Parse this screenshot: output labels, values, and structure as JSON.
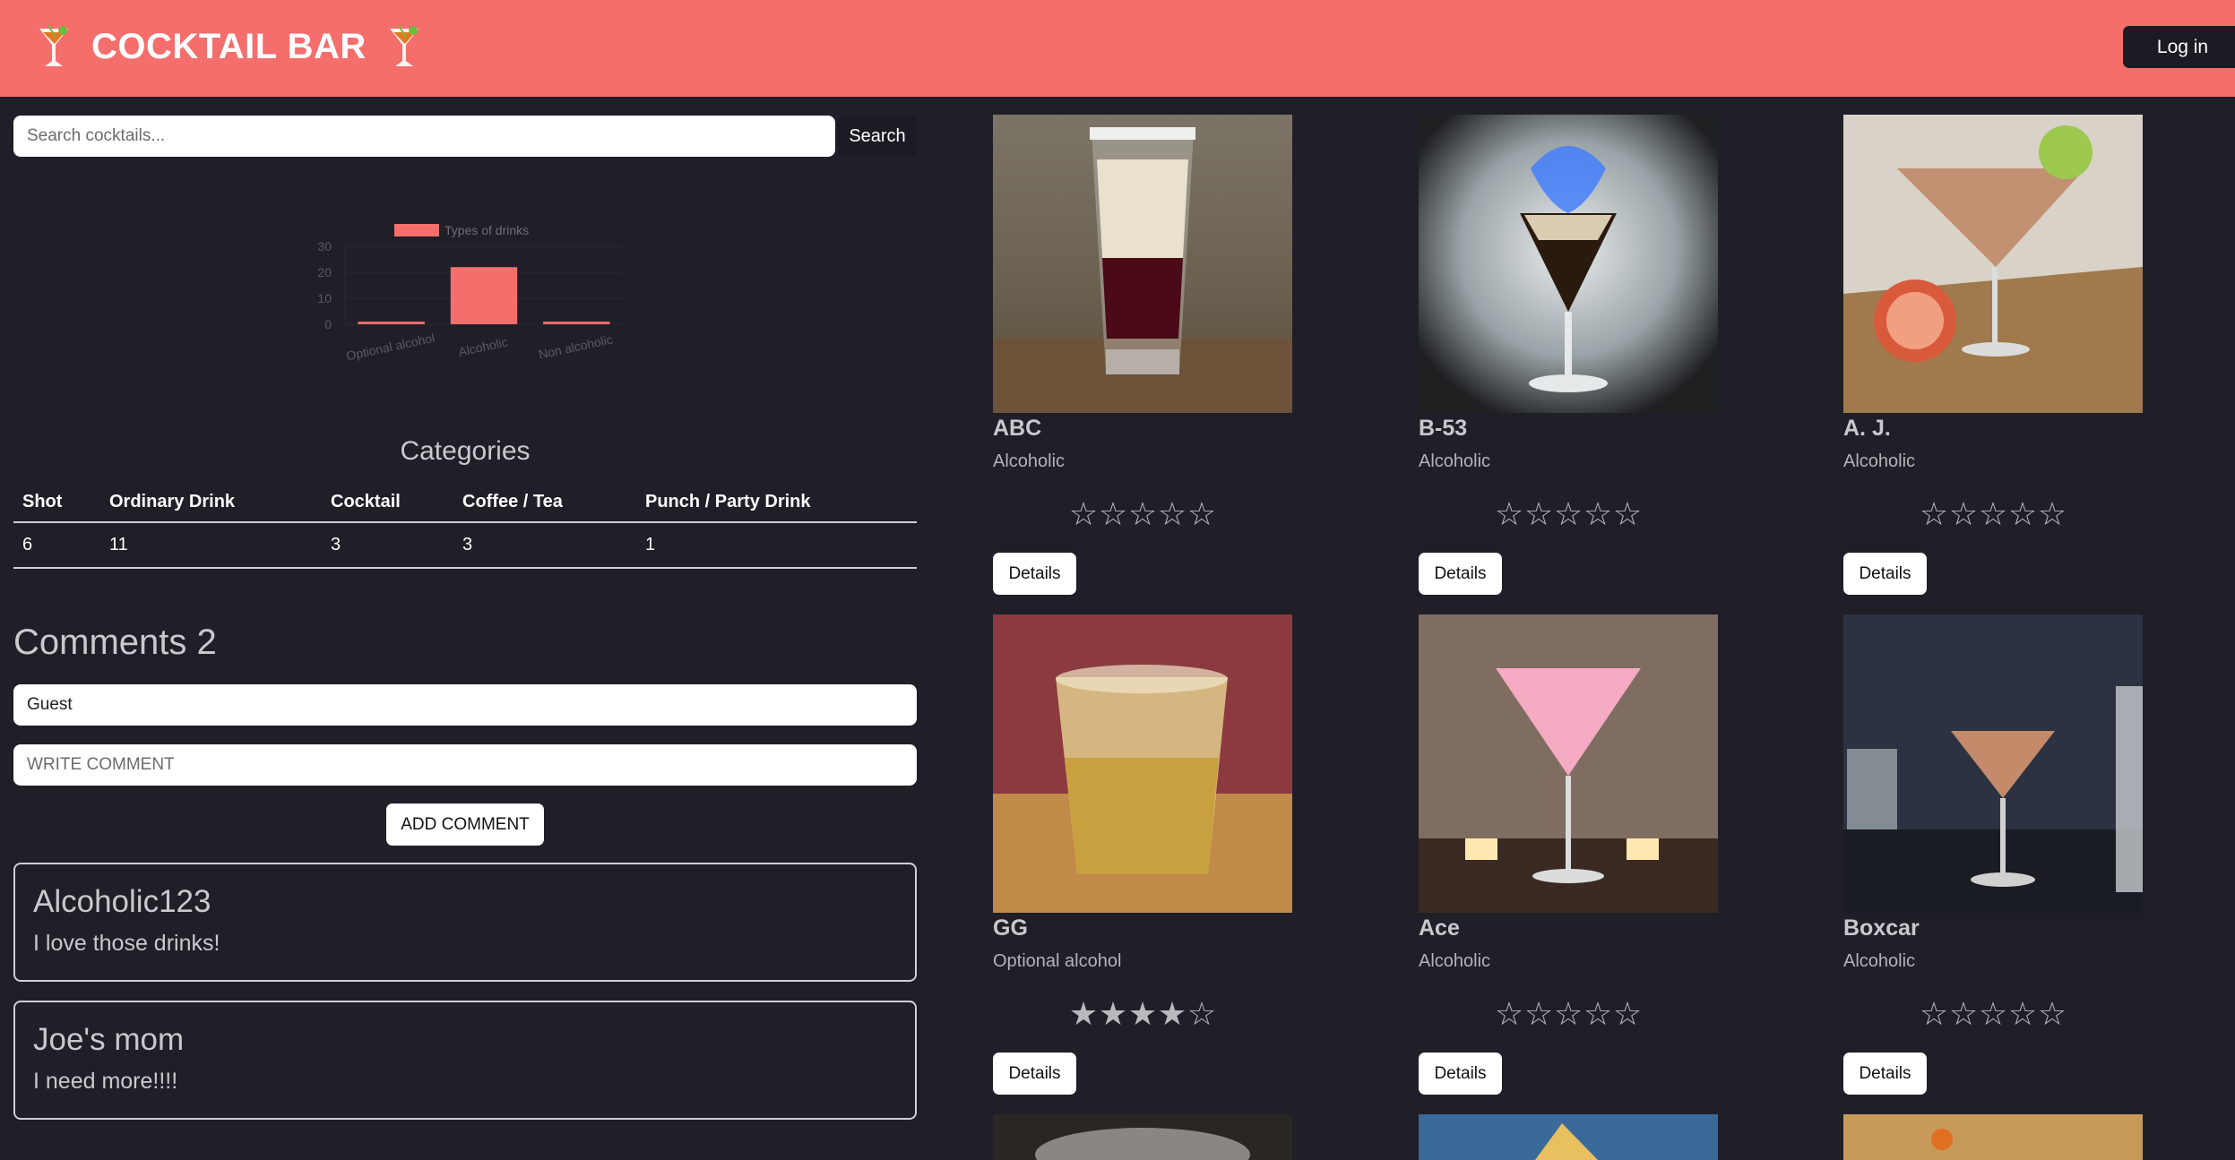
{
  "header": {
    "title": "COCKTAIL BAR",
    "login_label": "Log in"
  },
  "search": {
    "placeholder": "Search cocktails...",
    "button_label": "Search"
  },
  "chart_data": {
    "type": "bar",
    "categories": [
      "Optional alcohol",
      "Alcoholic",
      "Non alcoholic"
    ],
    "series": [
      {
        "name": "Types of drinks",
        "values": [
          1,
          22,
          1
        ]
      }
    ],
    "ylim": [
      0,
      30
    ],
    "yticks": [
      0,
      10,
      20,
      30
    ],
    "legend": "top",
    "color": "#f46e6c"
  },
  "categories": {
    "title": "Categories",
    "headers": [
      "Shot",
      "Ordinary Drink",
      "Cocktail",
      "Coffee / Tea",
      "Punch / Party Drink"
    ],
    "values": [
      "6",
      "11",
      "3",
      "3",
      "1"
    ]
  },
  "comments": {
    "title": "Comments 2",
    "name_value": "Guest",
    "comment_placeholder": "WRITE COMMENT",
    "add_label": "ADD COMMENT",
    "items": [
      {
        "author": "Alcoholic123",
        "text": "I love those drinks!"
      },
      {
        "author": "Joe's mom",
        "text": "I need more!!!!"
      }
    ]
  },
  "cards": [
    {
      "name": "ABC",
      "type": "Alcoholic",
      "rating": 0,
      "details_label": "Details"
    },
    {
      "name": "B-53",
      "type": "Alcoholic",
      "rating": 0,
      "details_label": "Details"
    },
    {
      "name": "A. J.",
      "type": "Alcoholic",
      "rating": 0,
      "details_label": "Details"
    },
    {
      "name": "GG",
      "type": "Optional alcohol",
      "rating": 4,
      "details_label": "Details"
    },
    {
      "name": "Ace",
      "type": "Alcoholic",
      "rating": 0,
      "details_label": "Details"
    },
    {
      "name": "Boxcar",
      "type": "Alcoholic",
      "rating": 0,
      "details_label": "Details"
    }
  ],
  "colors": {
    "accent": "#f46e6c",
    "background": "#201e27"
  }
}
